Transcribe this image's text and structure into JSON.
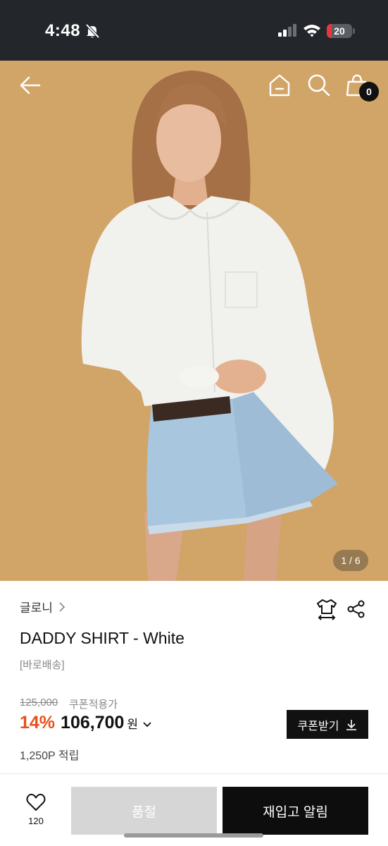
{
  "status_bar": {
    "time": "4:48",
    "battery_level": "20",
    "battery_fraction": 0.2,
    "battery_color": "#e5383b",
    "icons": [
      "bell-muted-icon",
      "signal-icon",
      "wifi-icon",
      "battery-icon"
    ]
  },
  "hero": {
    "background_color": "#d0a366",
    "page_indicator": "1 / 6",
    "cart_count": "0",
    "icons": [
      "back-arrow-icon",
      "home-icon",
      "search-icon",
      "shopping-bag-icon"
    ]
  },
  "product": {
    "brand": "글로니",
    "name": "DADDY SHIRT - White",
    "shipping_tag": "[바로배송]",
    "original_price": "125,000",
    "coupon_price_label": "쿠폰적용가",
    "discount": "14%",
    "price": "106,700",
    "currency": "원",
    "points": "1,250P 적립",
    "coupon_button_label": "쿠폰받기",
    "discount_color": "#e8501e",
    "icons": [
      "size-guide-icon",
      "share-icon",
      "download-icon"
    ]
  },
  "bottom_bar": {
    "wishlist_count": "120",
    "soldout_label": "품절",
    "notify_label": "재입고 알림",
    "icons": [
      "heart-icon"
    ]
  }
}
